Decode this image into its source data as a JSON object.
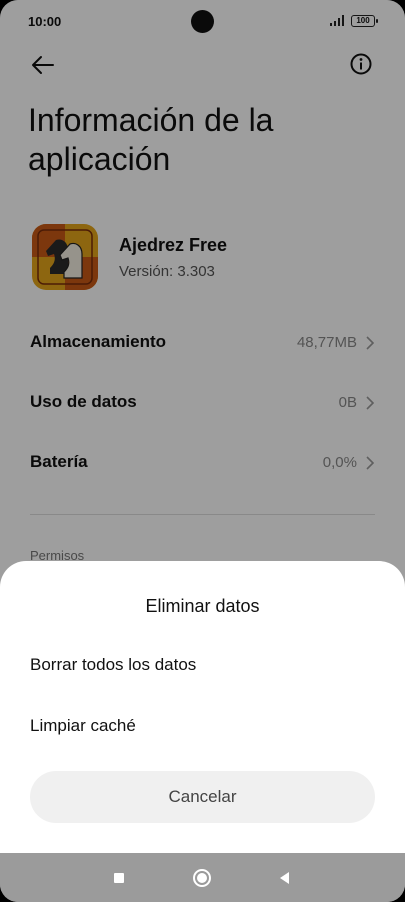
{
  "status_bar": {
    "time": "10:00",
    "battery": "100"
  },
  "header": {
    "title": "Información de la aplicación"
  },
  "app": {
    "name": "Ajedrez Free",
    "version": "Versión: 3.303"
  },
  "rows": [
    {
      "label": "Almacenamiento",
      "value": "48,77MB"
    },
    {
      "label": "Uso de datos",
      "value": "0B"
    },
    {
      "label": "Batería",
      "value": "0,0%"
    }
  ],
  "permissions_label": "Permisos",
  "sheet": {
    "title": "Eliminar datos",
    "options": [
      "Borrar todos los datos",
      "Limpiar caché"
    ],
    "cancel_label": "Cancelar"
  },
  "colors": {
    "scrim": "#000000",
    "sheet": "#ffffff",
    "cancel_bg": "#f0f0f0",
    "nav_bar": "#9b9b9b"
  },
  "icons": [
    "back-arrow-icon",
    "info-icon",
    "chevron-right-icon",
    "app-icon-chess-knight",
    "signal-icon",
    "battery-icon",
    "recents-icon",
    "home-icon",
    "back-triangle-icon"
  ]
}
